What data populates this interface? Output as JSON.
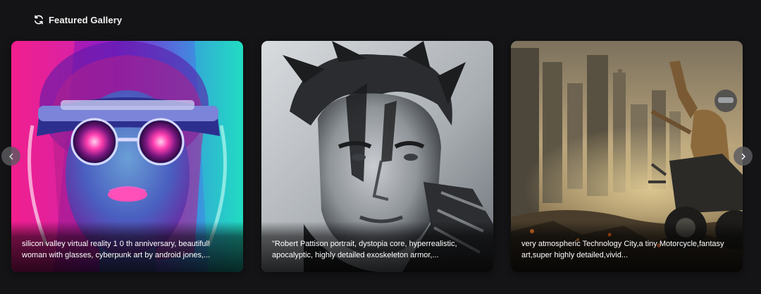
{
  "gallery": {
    "title": "Featured Gallery",
    "title_icon": "refresh-icon",
    "prev_icon": "chevron-left-icon",
    "next_icon": "chevron-right-icon",
    "items": [
      {
        "caption": "silicon valley virtual reality 1 0 th anniversary, beautiful! woman with glasses, cyberpunk art by android jones,...",
        "palette": [
          "#ff2fa3",
          "#7a2cff",
          "#25e0c6"
        ]
      },
      {
        "caption": "\"Robert Pattison portrait, dystopia core, hyperrealistic, apocalyptic, highly detailed exoskeleton armor,...",
        "palette": [
          "#cfd2d5",
          "#3b3f44",
          "#16181a"
        ]
      },
      {
        "caption": "very atmospheric Technology City,a tiny Motorcycle,fantasy art,super highly detailed,vivid...",
        "palette": [
          "#b59d6c",
          "#5f513a",
          "#2a2319"
        ]
      }
    ]
  }
}
